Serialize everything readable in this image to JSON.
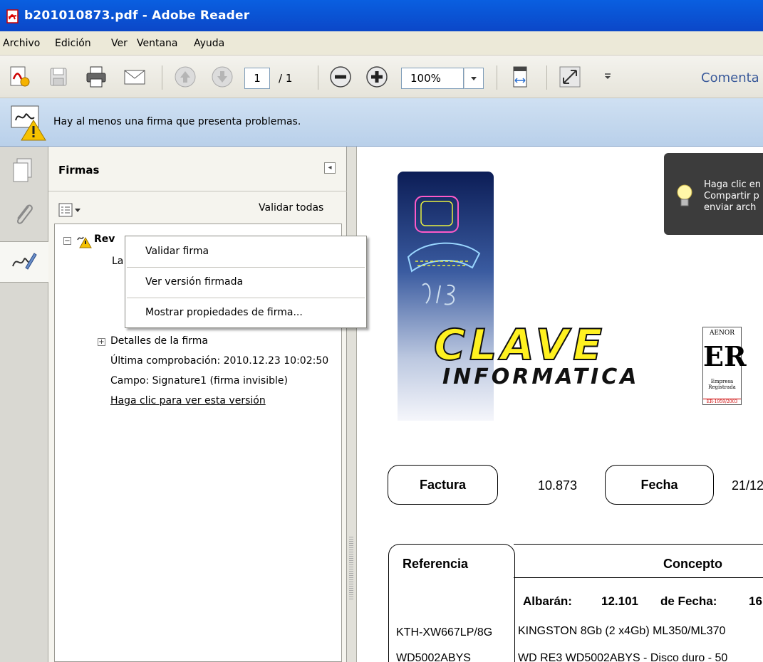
{
  "window": {
    "title": "b201010873.pdf - Adobe Reader"
  },
  "menubar": {
    "items": [
      "Archivo",
      "Edición",
      "Ver",
      "Ventana",
      "Ayuda"
    ]
  },
  "toolbar": {
    "page_current": "1",
    "page_total": "/ 1",
    "zoom": "100%",
    "comment_label": "Comenta"
  },
  "message_bar": {
    "text": "Hay al menos una firma que presenta problemas."
  },
  "signatures_panel": {
    "title": "Firmas",
    "validate_all": "Validar todas",
    "signature_name": "Rev",
    "sig_line_partial": "La",
    "details_label": "Detalles de la firma",
    "last_check": "Última comprobación: 2010.12.23 10:02:50",
    "field": "Campo: Signature1 (firma invisible)",
    "view_version_link": "Haga clic para ver esta versión"
  },
  "context_menu": {
    "items": [
      "Validar firma",
      "Ver versión firmada",
      "Mostrar propiedades de firma..."
    ]
  },
  "tooltip": {
    "lines": [
      "Haga clic en",
      "Compartir p",
      "enviar arch"
    ]
  },
  "document": {
    "logo_top": "CLAVE",
    "logo_bottom": "INFORMATICA",
    "aenor_brand": "AENOR",
    "aenor_mark": "ER",
    "aenor_sub1": "Empresa",
    "aenor_sub2": "Registrada",
    "aenor_code": "ER-1959/2003",
    "factura_label": "Factura",
    "factura_value": "10.873",
    "fecha_label": "Fecha",
    "fecha_value": "21/12",
    "referencia_header": "Referencia",
    "concepto_header": "Concepto",
    "albaran_label": "Albarán:",
    "albaran_value": "12.101",
    "de_fecha_label": "de Fecha:",
    "de_fecha_value": "16",
    "rows": [
      {
        "ref": "KTH-XW667LP/8G",
        "concept": "KINGSTON 8Gb  (2 x4Gb) ML350/ML370"
      },
      {
        "ref": "WD5002ABYS",
        "concept": "WD RE3 WD5002ABYS - Disco duro - 50"
      }
    ]
  },
  "colors": {
    "titlebar": "#0b47c8",
    "message_bar": "#c4d8ef",
    "logo_yellow": "#fff120"
  }
}
